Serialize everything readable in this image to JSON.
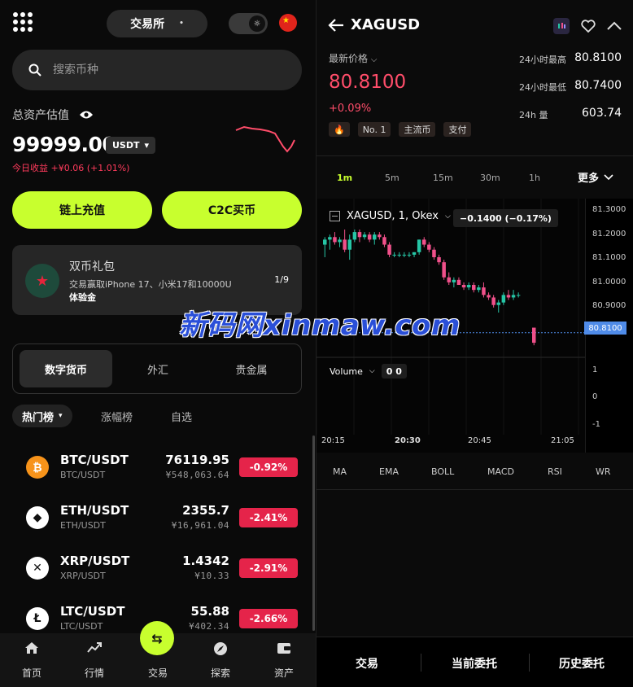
{
  "left": {
    "exchange_label": "交易所",
    "search_placeholder": "搜索币种",
    "asset_label": "总资产估值",
    "asset_value": "99999.00",
    "asset_unit": "USDT",
    "today_label": "今日收益",
    "today_value": "+¥0.06 (+1.01%)",
    "deposit_label": "链上充值",
    "c2c_label": "C2C买币",
    "promo": {
      "title": "双币礼包",
      "desc": "交易赢取iPhone 17、小米17和10000U",
      "desc2": "体验金",
      "page": "1/9"
    },
    "segments": [
      "数字货币",
      "外汇",
      "贵金属"
    ],
    "subtabs": [
      "热门榜",
      "涨幅榜",
      "自选"
    ],
    "coins": [
      {
        "pair": "BTC/USDT",
        "sub": "BTC/USDT",
        "price": "76119.95",
        "cny": "¥548,063.64",
        "change": "-0.92%",
        "color": "#f7931a",
        "glyph": "₿"
      },
      {
        "pair": "ETH/USDT",
        "sub": "ETH/USDT",
        "price": "2355.7",
        "cny": "¥16,961.04",
        "change": "-2.41%",
        "color": "#ffffff",
        "glyph": "◆"
      },
      {
        "pair": "XRP/USDT",
        "sub": "XRP/USDT",
        "price": "1.4342",
        "cny": "¥10.33",
        "change": "-2.91%",
        "color": "#ffffff",
        "glyph": "✕"
      },
      {
        "pair": "LTC/USDT",
        "sub": "LTC/USDT",
        "price": "55.88",
        "cny": "¥402.34",
        "change": "-2.66%",
        "color": "#e8e8e8",
        "glyph": "Ł"
      }
    ],
    "nav": [
      "首页",
      "行情",
      "交易",
      "探索",
      "资产"
    ]
  },
  "right": {
    "symbol": "XAGUSD",
    "latest_label": "最新价格",
    "price": "80.8100",
    "pct": "+0.09%",
    "tags": [
      "🔥",
      "No. 1",
      "主流币",
      "支付"
    ],
    "stats": [
      {
        "label": "24小时最高",
        "value": "80.8100"
      },
      {
        "label": "24小时最低",
        "value": "80.7400"
      },
      {
        "label": "24h 量",
        "value": "603.74"
      }
    ],
    "intervals": [
      "1m",
      "5m",
      "15m",
      "30m",
      "1h"
    ],
    "more_label": "更多",
    "chart_title": "XAGUSD, 1, Okex",
    "chart_change": "−0.1400 (−0.17%)",
    "volume_label": "Volume",
    "volume_value": "0 0",
    "indicators": [
      "MA",
      "EMA",
      "BOLL",
      "MACD",
      "RSI",
      "WR"
    ],
    "bottom_tabs": [
      "交易",
      "当前委托",
      "历史委托"
    ],
    "accent_up": "#26c6a6",
    "accent_down": "#f0508a"
  },
  "chart_data": {
    "type": "candlestick",
    "title": "XAGUSD, 1, Okex",
    "y_ticks": [
      "81.3000",
      "81.2000",
      "81.1000",
      "81.0000",
      "80.9000"
    ],
    "ylim": [
      80.78,
      81.33
    ],
    "current_price": "80.8100",
    "x_ticks": [
      "20:15",
      "20:30",
      "20:45",
      "21:05"
    ],
    "volume_ticks": [
      "1",
      "0",
      "-1"
    ],
    "candles": [
      {
        "o": 81.16,
        "h": 81.19,
        "l": 81.11,
        "c": 81.18
      },
      {
        "o": 81.18,
        "h": 81.2,
        "l": 81.14,
        "c": 81.19
      },
      {
        "o": 81.19,
        "h": 81.21,
        "l": 81.16,
        "c": 81.17
      },
      {
        "o": 81.17,
        "h": 81.19,
        "l": 81.15,
        "c": 81.18
      },
      {
        "o": 81.18,
        "h": 81.22,
        "l": 81.13,
        "c": 81.14
      },
      {
        "o": 81.14,
        "h": 81.2,
        "l": 81.1,
        "c": 81.18
      },
      {
        "o": 81.18,
        "h": 81.22,
        "l": 81.17,
        "c": 81.21
      },
      {
        "o": 81.21,
        "h": 81.22,
        "l": 81.17,
        "c": 81.19
      },
      {
        "o": 81.19,
        "h": 81.21,
        "l": 81.18,
        "c": 81.2
      },
      {
        "o": 81.2,
        "h": 81.21,
        "l": 81.17,
        "c": 81.18
      },
      {
        "o": 81.18,
        "h": 81.21,
        "l": 81.16,
        "c": 81.2
      },
      {
        "o": 81.2,
        "h": 81.21,
        "l": 81.18,
        "c": 81.19
      },
      {
        "o": 81.19,
        "h": 81.2,
        "l": 81.15,
        "c": 81.16
      },
      {
        "o": 81.16,
        "h": 81.17,
        "l": 81.11,
        "c": 81.12
      },
      {
        "o": 81.12,
        "h": 81.13,
        "l": 81.11,
        "c": 81.12
      },
      {
        "o": 81.12,
        "h": 81.13,
        "l": 81.11,
        "c": 81.12
      },
      {
        "o": 81.12,
        "h": 81.13,
        "l": 81.11,
        "c": 81.12
      },
      {
        "o": 81.12,
        "h": 81.13,
        "l": 81.11,
        "c": 81.12
      },
      {
        "o": 81.12,
        "h": 81.13,
        "l": 81.11,
        "c": 81.13
      },
      {
        "o": 81.13,
        "h": 81.18,
        "l": 81.12,
        "c": 81.18
      },
      {
        "o": 81.18,
        "h": 81.19,
        "l": 81.15,
        "c": 81.16
      },
      {
        "o": 81.16,
        "h": 81.17,
        "l": 81.13,
        "c": 81.14
      },
      {
        "o": 81.14,
        "h": 81.15,
        "l": 81.1,
        "c": 81.11
      },
      {
        "o": 81.11,
        "h": 81.12,
        "l": 81.08,
        "c": 81.09
      },
      {
        "o": 81.09,
        "h": 81.1,
        "l": 81.02,
        "c": 81.03
      },
      {
        "o": 81.03,
        "h": 81.05,
        "l": 81.0,
        "c": 81.01
      },
      {
        "o": 81.01,
        "h": 81.03,
        "l": 80.99,
        "c": 81.02
      },
      {
        "o": 81.02,
        "h": 81.03,
        "l": 81.0,
        "c": 81.0
      },
      {
        "o": 81.0,
        "h": 81.01,
        "l": 80.98,
        "c": 80.99
      },
      {
        "o": 80.99,
        "h": 81.01,
        "l": 80.98,
        "c": 81.0
      },
      {
        "o": 81.0,
        "h": 81.01,
        "l": 80.97,
        "c": 80.98
      },
      {
        "o": 80.98,
        "h": 81.0,
        "l": 80.97,
        "c": 80.99
      },
      {
        "o": 80.99,
        "h": 81.01,
        "l": 80.95,
        "c": 80.96
      },
      {
        "o": 80.96,
        "h": 80.97,
        "l": 80.94,
        "c": 80.95
      },
      {
        "o": 80.95,
        "h": 80.96,
        "l": 80.91,
        "c": 80.92
      },
      {
        "o": 80.92,
        "h": 80.94,
        "l": 80.89,
        "c": 80.93
      },
      {
        "o": 80.93,
        "h": 80.97,
        "l": 80.92,
        "c": 80.96
      },
      {
        "o": 80.96,
        "h": 80.98,
        "l": 80.94,
        "c": 80.95
      },
      {
        "o": 80.95,
        "h": 80.98,
        "l": 80.94,
        "c": 80.96
      },
      {
        "o": 80.96,
        "h": 80.97,
        "l": 80.95,
        "c": 80.96
      },
      {
        "o": 80.83,
        "h": 80.83,
        "l": 80.76,
        "c": 80.77
      }
    ]
  }
}
